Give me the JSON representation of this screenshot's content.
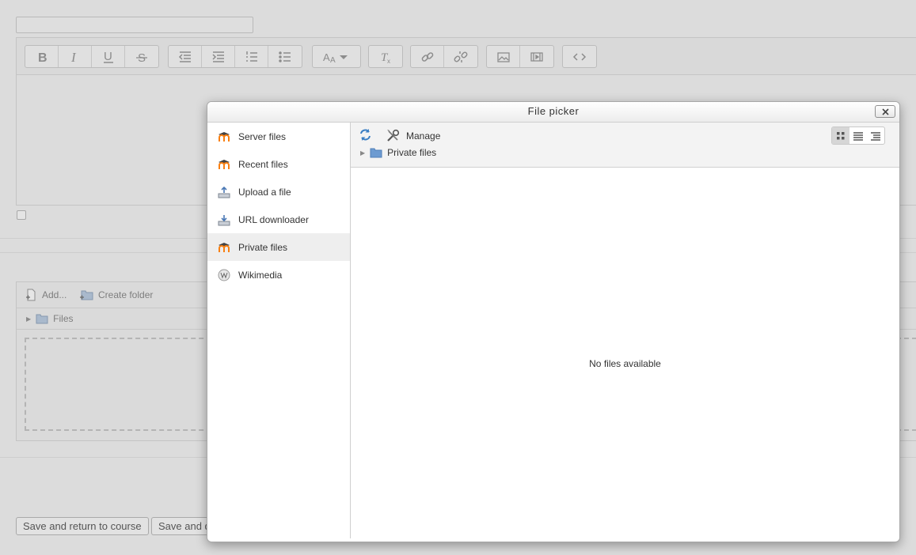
{
  "background": {
    "file_manager": {
      "add_label": "Add...",
      "create_folder_label": "Create folder",
      "path_label": "Files"
    },
    "buttons": {
      "save_return": "Save and return to course",
      "save_display": "Save and d"
    }
  },
  "dialog": {
    "title": "File picker",
    "sidebar": {
      "items": [
        {
          "label": "Server files",
          "icon": "moodle-icon"
        },
        {
          "label": "Recent files",
          "icon": "moodle-icon"
        },
        {
          "label": "Upload a file",
          "icon": "upload-icon"
        },
        {
          "label": "URL downloader",
          "icon": "url-download-icon"
        },
        {
          "label": "Private files",
          "icon": "moodle-icon",
          "active": true
        },
        {
          "label": "Wikimedia",
          "icon": "wikimedia-icon"
        }
      ]
    },
    "toolbar": {
      "manage_label": "Manage",
      "breadcrumb": "Private files",
      "view_mode": "icons"
    },
    "empty_message": "No files available"
  },
  "colors": {
    "moodle_orange": "#f98012",
    "folder_blue": "#6d9bd1",
    "refresh_blue": "#3b7fc4"
  }
}
